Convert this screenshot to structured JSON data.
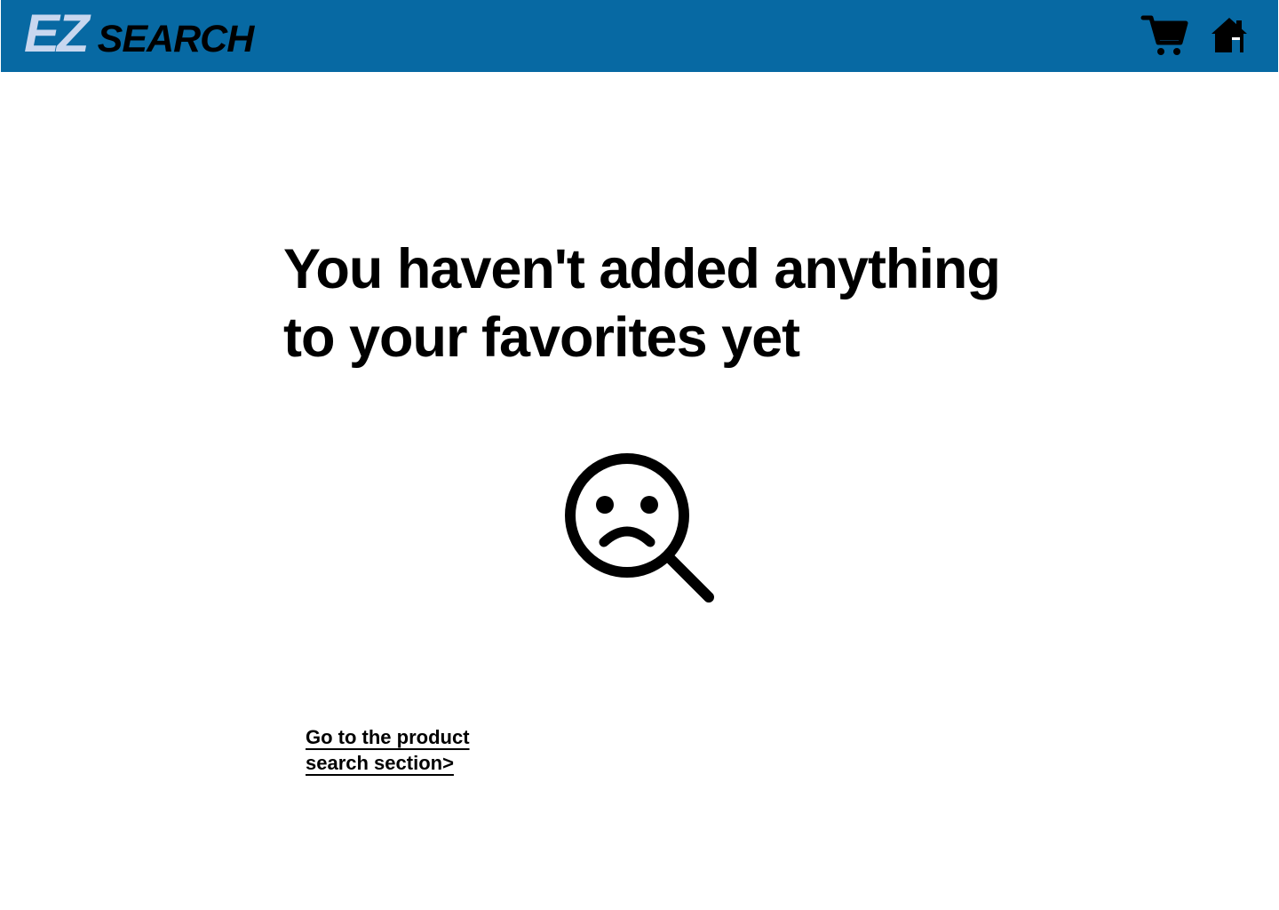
{
  "header": {
    "logo": {
      "prefix": "EZ",
      "text": "SEARCH",
      "prefix_color": "#c8d7ef",
      "text_color": "#000000"
    },
    "background_color": "#0769a3",
    "icons": [
      {
        "name": "shopping-cart-icon"
      },
      {
        "name": "home-icon"
      }
    ]
  },
  "main": {
    "headline": {
      "line1": "You haven't added anything",
      "line2": "to your favorites yet"
    },
    "illustration": {
      "name": "sad-magnifier-icon"
    },
    "link": {
      "line1": "Go to the product",
      "line2": "search section>"
    }
  }
}
